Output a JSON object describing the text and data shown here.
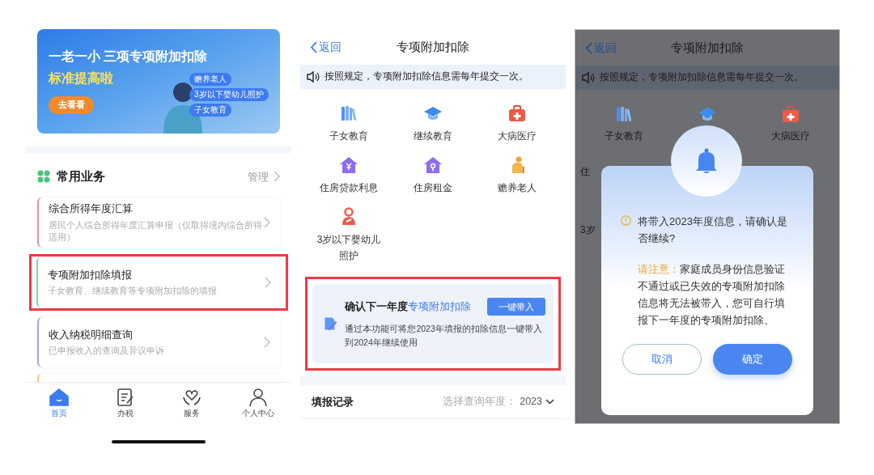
{
  "home": {
    "banner": {
      "headline": "一老一小 三项专项附加扣除",
      "subheadline": "标准提高啦",
      "button": "去看看",
      "tags": [
        "赡养老人",
        "3岁以下婴幼儿照护",
        "子女教育"
      ]
    },
    "section": {
      "title": "常用业务",
      "manage": "管理"
    },
    "cards": [
      {
        "title": "综合所得年度汇算",
        "subtitle": "居民个人综合所得年度汇算申报（仅取得境内综合所得适用）",
        "color": "#e88aa6",
        "highlighted": false
      },
      {
        "title": "专项附加扣除填报",
        "subtitle": "子女教育、继续教育等专项附加扣除的填报",
        "color": "#7fd49b",
        "highlighted": true
      },
      {
        "title": "收入纳税明细查询",
        "subtitle": "已申报收入的查询及异议申诉",
        "color": "#a9a0e6",
        "highlighted": false
      }
    ],
    "tabs": [
      {
        "label": "首页",
        "selected": true
      },
      {
        "label": "办税",
        "selected": false
      },
      {
        "label": "服务",
        "selected": false
      },
      {
        "label": "个人中心",
        "selected": false
      }
    ]
  },
  "deductions": {
    "back": "返回",
    "title": "专项附加扣除",
    "notice": "按照规定，专项附加扣除信息需每年提交一次。",
    "items": [
      {
        "label": "子女教育"
      },
      {
        "label": "继续教育"
      },
      {
        "label": "大病医疗"
      },
      {
        "label": "住房贷款利息"
      },
      {
        "label": "住房租金"
      },
      {
        "label": "赡养老人"
      },
      {
        "label": "3岁以下婴幼儿照护"
      }
    ],
    "carry_card": {
      "title": "确认下一年度",
      "title_highlight": "专项附加扣除",
      "button": "一键带入",
      "description": "通过本功能可将您2023年填报的扣除信息一键带入到2024年继续使用",
      "highlighted": true
    },
    "records": {
      "title": "填报记录",
      "year_label": "选择查询年度：",
      "year": "2023"
    }
  },
  "dialog_screen": {
    "back": "返回",
    "title": "专项附加扣除",
    "notice": "按照规定，专项附加扣除信息需每年提交一次。",
    "items": [
      {
        "label": "子女教育"
      },
      {
        "label": "大病医疗"
      }
    ],
    "fragments": [
      "住",
      "3岁"
    ],
    "dialog": {
      "message": "将带入2023年度信息，请确认是否继续?",
      "note_label": "请注意：",
      "note": "家庭成员身份信息验证不通过或已失效的专项附加扣除信息将无法被带入，您可自行填报下一年度的专项附加扣除。",
      "cancel": "取消",
      "confirm": "确定"
    }
  }
}
